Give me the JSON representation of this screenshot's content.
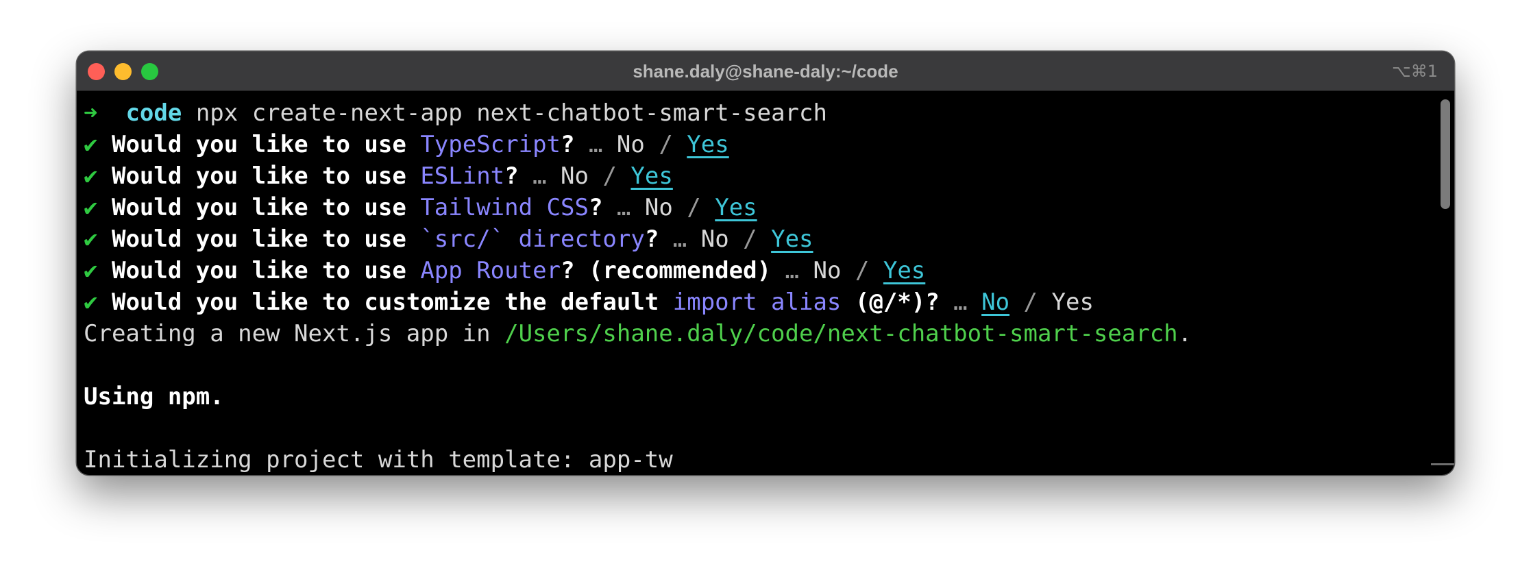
{
  "window": {
    "title": "shane.daly@shane-daly:~/code",
    "shortcut": "⌥⌘1"
  },
  "terminal": {
    "prompt": {
      "arrow": "➜",
      "dir": "code",
      "command": "npx create-next-app next-chatbot-smart-search"
    },
    "questions": [
      {
        "check": "✔",
        "prefix": "Would you like to use ",
        "highlight": "TypeScript",
        "suffix": "?",
        "ellipsis": " … ",
        "no": "No",
        "sep": " / ",
        "yes": "Yes",
        "selected": "yes"
      },
      {
        "check": "✔",
        "prefix": "Would you like to use ",
        "highlight": "ESLint",
        "suffix": "?",
        "ellipsis": " … ",
        "no": "No",
        "sep": " / ",
        "yes": "Yes",
        "selected": "yes"
      },
      {
        "check": "✔",
        "prefix": "Would you like to use ",
        "highlight": "Tailwind CSS",
        "suffix": "?",
        "ellipsis": " … ",
        "no": "No",
        "sep": " / ",
        "yes": "Yes",
        "selected": "yes"
      },
      {
        "check": "✔",
        "prefix": "Would you like to use ",
        "highlight": "`src/` directory",
        "suffix": "?",
        "ellipsis": " … ",
        "no": "No",
        "sep": " / ",
        "yes": "Yes",
        "selected": "yes"
      },
      {
        "check": "✔",
        "prefix": "Would you like to use ",
        "highlight": "App Router",
        "suffix": "? (recommended)",
        "ellipsis": " … ",
        "no": "No",
        "sep": " / ",
        "yes": "Yes",
        "selected": "yes"
      },
      {
        "check": "✔",
        "prefix": "Would you like to customize the default ",
        "highlight": "import alias",
        "suffix": " (@/*)?",
        "ellipsis": " … ",
        "no": "No",
        "sep": " / ",
        "yes": "Yes",
        "selected": "no"
      }
    ],
    "creating": {
      "prefix": "Creating a new Next.js app in ",
      "path": "/Users/shane.daly/code/next-chatbot-smart-search",
      "suffix": "."
    },
    "using": "Using npm.",
    "initializing": "Initializing project with template: app-tw"
  },
  "colors": {
    "titlebar": "#3a3a3c",
    "background": "#000000",
    "check": "#2fca41",
    "highlight": "#8a86ff",
    "selected": "#3ec6d8",
    "path": "#4fd04c"
  }
}
